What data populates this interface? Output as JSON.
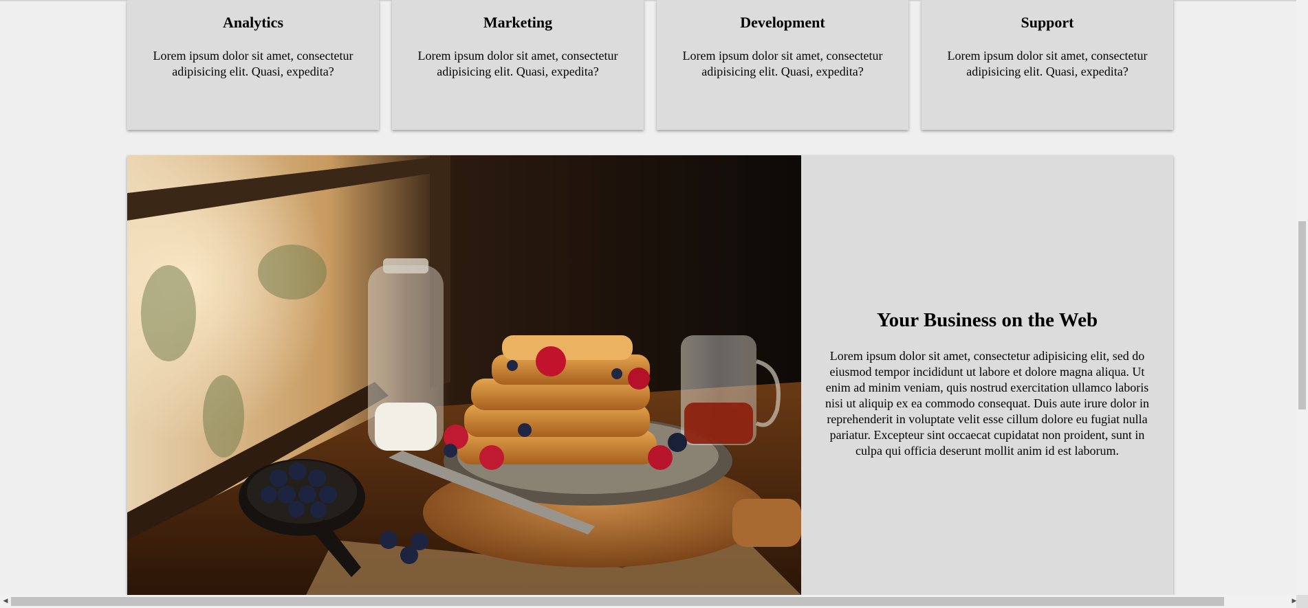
{
  "cards": [
    {
      "title": "Analytics",
      "text": "Lorem ipsum dolor sit amet, consectetur adipisicing elit. Quasi, expedita?"
    },
    {
      "title": "Marketing",
      "text": "Lorem ipsum dolor sit amet, consectetur adipisicing elit. Quasi, expedita?"
    },
    {
      "title": "Development",
      "text": "Lorem ipsum dolor sit amet, consectetur adipisicing elit. Quasi, expedita?"
    },
    {
      "title": "Support",
      "text": "Lorem ipsum dolor sit amet, consectetur adipisicing elit. Quasi, expedita?"
    }
  ],
  "feature": {
    "title": "Your Business on the Web",
    "text": "Lorem ipsum dolor sit amet, consectetur adipisicing elit, sed do eiusmod tempor incididunt ut labore et dolore magna aliqua. Ut enim ad minim veniam, quis nostrud exercitation ullamco laboris nisi ut aliquip ex ea commodo consequat. Duis aute irure dolor in reprehenderit in voluptate velit esse cillum dolore eu fugiat nulla pariatur. Excepteur sint occaecat cupidatat non proident, sunt in culpa qui officia deserunt mollit anim id est laborum."
  },
  "scrollbars": {
    "left_arrow": "◀",
    "right_arrow": "▶"
  },
  "colors": {
    "page_background": "#efefef",
    "card_background": "#dcdcdc",
    "scroll_thumb": "#c1c1c1"
  }
}
